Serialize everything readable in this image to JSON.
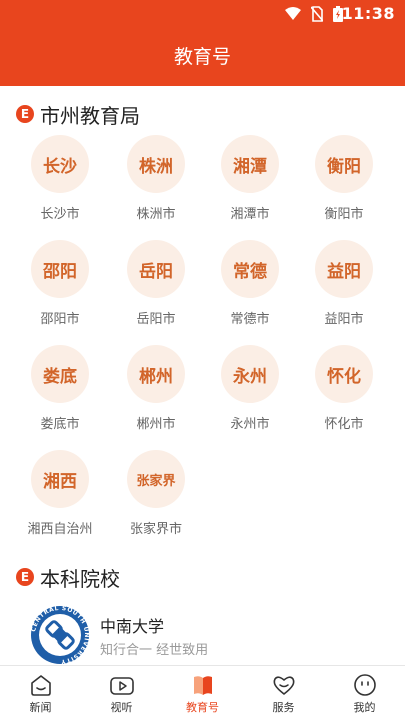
{
  "status": {
    "time": "11:38"
  },
  "header": {
    "title": "教育号"
  },
  "section1": {
    "badge": "E",
    "title": "市州教育局"
  },
  "cities": [
    {
      "short": "长沙",
      "name": "长沙市"
    },
    {
      "short": "株洲",
      "name": "株洲市"
    },
    {
      "short": "湘潭",
      "name": "湘潭市"
    },
    {
      "short": "衡阳",
      "name": "衡阳市"
    },
    {
      "short": "邵阳",
      "name": "邵阳市"
    },
    {
      "short": "岳阳",
      "name": "岳阳市"
    },
    {
      "short": "常德",
      "name": "常德市"
    },
    {
      "short": "益阳",
      "name": "益阳市"
    },
    {
      "short": "娄底",
      "name": "娄底市"
    },
    {
      "short": "郴州",
      "name": "郴州市"
    },
    {
      "short": "永州",
      "name": "永州市"
    },
    {
      "short": "怀化",
      "name": "怀化市"
    },
    {
      "short": "湘西",
      "name": "湘西自治州"
    },
    {
      "short": "张家界",
      "name": "张家界市"
    }
  ],
  "section2": {
    "badge": "E",
    "title": "本科院校"
  },
  "school": {
    "name": "中南大学",
    "motto": "知行合一 经世致用",
    "logo_text": "CENTRAL SOUTH UNIVERSITY"
  },
  "tabs": [
    {
      "label": "新闻",
      "icon": "home-icon"
    },
    {
      "label": "视听",
      "icon": "video-icon"
    },
    {
      "label": "教育号",
      "icon": "book-icon"
    },
    {
      "label": "服务",
      "icon": "heart-icon"
    },
    {
      "label": "我的",
      "icon": "profile-icon"
    }
  ],
  "colors": {
    "accent": "#e8451e",
    "circle_bg": "#fbeee5",
    "circle_text": "#d2652a"
  }
}
